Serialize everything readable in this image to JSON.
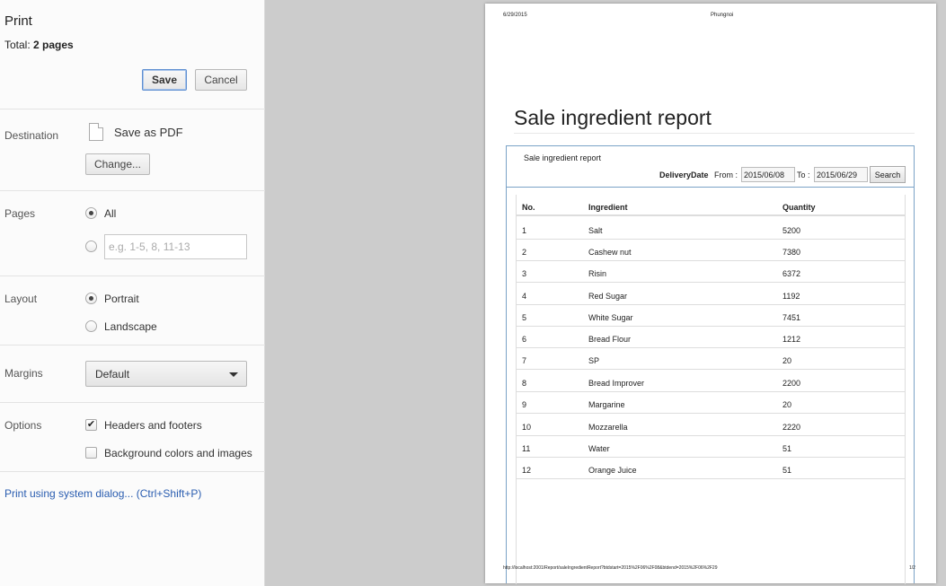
{
  "panel": {
    "title": "Print",
    "total_label": "Total: ",
    "total_value": "2 pages",
    "save_label": "Save",
    "cancel_label": "Cancel",
    "destination": {
      "label": "Destination",
      "value": "Save as PDF",
      "change_label": "Change..."
    },
    "pages": {
      "label": "Pages",
      "all_label": "All",
      "all_selected": true,
      "custom_placeholder": "e.g. 1-5, 8, 11-13"
    },
    "layout": {
      "label": "Layout",
      "portrait_label": "Portrait",
      "landscape_label": "Landscape",
      "selected": "Portrait"
    },
    "margins": {
      "label": "Margins",
      "value": "Default"
    },
    "options": {
      "label": "Options",
      "headers_label": "Headers and footers",
      "headers_checked": true,
      "background_label": "Background colors and images",
      "background_checked": false
    },
    "system_dialog_link": "Print using system dialog... (Ctrl+Shift+P)"
  },
  "preview": {
    "header_date": "6/29/2015",
    "header_title": "Phungnoi",
    "title": "Sale ingredient report",
    "box_title": "Sale ingredient report",
    "filter": {
      "field_label": "DeliveryDate",
      "from_label": "From :",
      "from_value": "2015/06/08",
      "to_label": "To :",
      "to_value": "2015/06/29",
      "search_label": "Search"
    },
    "table": {
      "headers": [
        "No.",
        "Ingredient",
        "Quantity"
      ],
      "rows": [
        [
          "1",
          "Salt",
          "5200"
        ],
        [
          "2",
          "Cashew nut",
          "7380"
        ],
        [
          "3",
          "Risin",
          "6372"
        ],
        [
          "4",
          "Red Sugar",
          "1192"
        ],
        [
          "5",
          "White Sugar",
          "7451"
        ],
        [
          "6",
          "Bread Flour",
          "1212"
        ],
        [
          "7",
          "SP",
          "20"
        ],
        [
          "8",
          "Bread Improver",
          "2200"
        ],
        [
          "9",
          "Margarine",
          "20"
        ],
        [
          "10",
          "Mozzarella",
          "2220"
        ],
        [
          "11",
          "Water",
          "51"
        ],
        [
          "12",
          "Orange Juice",
          "51"
        ]
      ]
    },
    "footer_url": "http://localhost:2001/Report/saleIngredientReport?btdstart=2015%2F06%2F08&btdend=2015%2F06%2F29",
    "footer_page": "1/2"
  }
}
